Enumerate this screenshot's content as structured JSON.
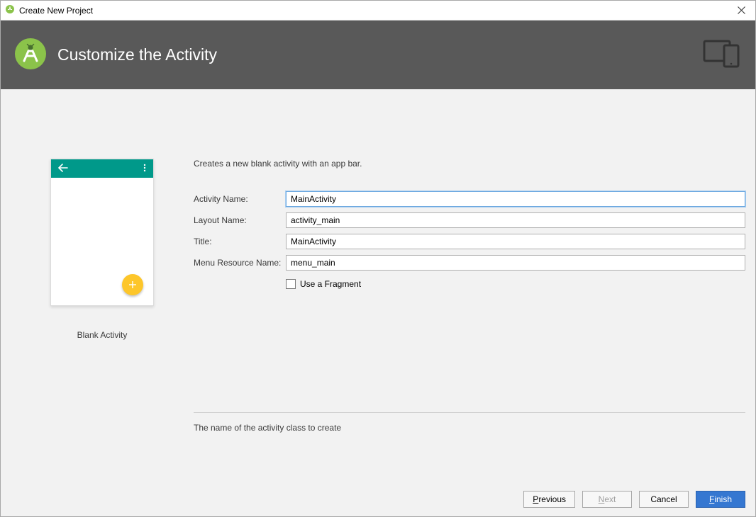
{
  "window": {
    "title": "Create New Project"
  },
  "header": {
    "title": "Customize the Activity"
  },
  "preview": {
    "label": "Blank Activity"
  },
  "form": {
    "description": "Creates a new blank activity with an app bar.",
    "activity_name_label": "Activity Name:",
    "activity_name_value": "MainActivity",
    "layout_name_label": "Layout Name:",
    "layout_name_value": "activity_main",
    "title_label": "Title:",
    "title_value": "MainActivity",
    "menu_resource_label": "Menu Resource Name:",
    "menu_resource_value": "menu_main",
    "use_fragment_label": "Use a Fragment",
    "help_text": "The name of the activity class to create"
  },
  "buttons": {
    "previous_first": "P",
    "previous_rest": "revious",
    "next_first": "N",
    "next_rest": "ext",
    "cancel": "Cancel",
    "finish_first": "F",
    "finish_rest": "inish"
  }
}
